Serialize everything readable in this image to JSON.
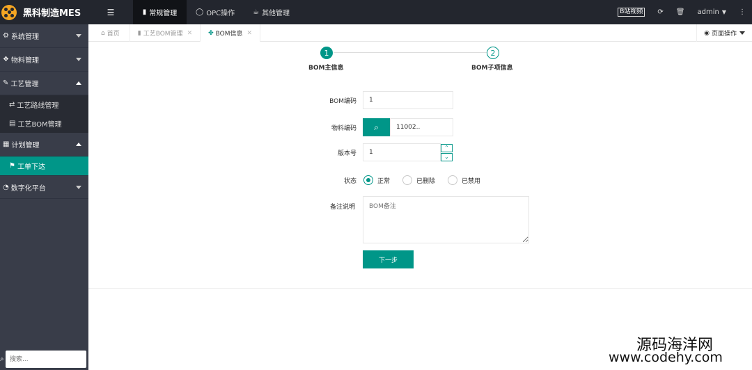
{
  "app": {
    "title": "黑科制造MES"
  },
  "header": {
    "nav": [
      {
        "icon": "doc-icon",
        "label": "常规管理",
        "active": true
      },
      {
        "icon": "circle-icon",
        "label": "OPC操作",
        "active": false
      },
      {
        "icon": "cup-icon",
        "label": "其他管理",
        "active": false
      }
    ],
    "video": "B站视频",
    "user": "admin"
  },
  "sidebar": {
    "groups": [
      {
        "label": "系统管理",
        "icon": "gears-icon",
        "expanded": false
      },
      {
        "label": "物料管理",
        "icon": "cubes-icon",
        "expanded": false
      },
      {
        "label": "工艺管理",
        "icon": "wrench-icon",
        "expanded": true,
        "items": [
          {
            "label": "工艺路线管理",
            "icon": "route-icon"
          },
          {
            "label": "工艺BOM管理",
            "icon": "file-icon"
          }
        ]
      },
      {
        "label": "计划管理",
        "icon": "calendar-icon",
        "expanded": true,
        "items": [
          {
            "label": "工单下达",
            "icon": "flag-icon",
            "active": true
          }
        ]
      },
      {
        "label": "数字化平台",
        "icon": "pie-icon",
        "expanded": false
      }
    ],
    "search_placeholder": "搜索..."
  },
  "tabs": [
    {
      "label": "首页",
      "icon": "home-icon",
      "closable": false
    },
    {
      "label": "工艺BOM管理",
      "icon": "file-icon",
      "closable": true
    },
    {
      "label": "BOM信息",
      "icon": "dropbox-icon",
      "closable": true,
      "active": true
    }
  ],
  "page_ops": "页面操作",
  "steps": [
    {
      "number": "1",
      "label": "BOM主信息",
      "done": true
    },
    {
      "number": "2",
      "label": "BOM子项信息",
      "done": false
    }
  ],
  "form": {
    "bom_code": {
      "label": "BOM编码",
      "value": "1"
    },
    "material_code": {
      "label": "物料编码",
      "value": "11002.."
    },
    "version": {
      "label": "版本号",
      "value": "1"
    },
    "status": {
      "label": "状态",
      "options": [
        "正常",
        "已删除",
        "已禁用"
      ],
      "selected": "正常"
    },
    "remark": {
      "label": "备注说明",
      "placeholder": "BOM备注"
    },
    "next_label": "下一步"
  },
  "watermark": {
    "line1": "源码海洋网",
    "line2": "www.codehy.com"
  },
  "colors": {
    "accent": "#009688",
    "topbar": "#23262e",
    "sidebar": "#393d49"
  }
}
